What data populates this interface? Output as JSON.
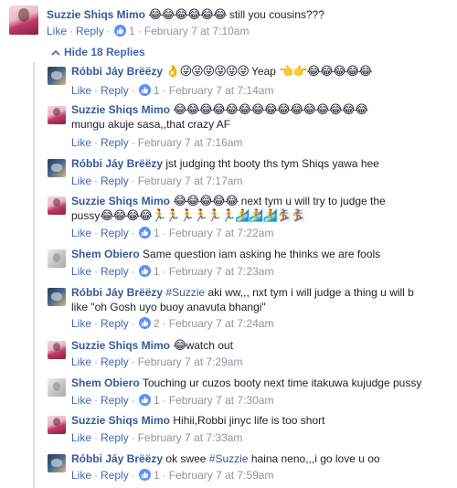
{
  "top_comment": {
    "author": "Suzzie Shiqs Mimo",
    "emojis": "😂😂😂😂😂😂",
    "text": "still you cousins???",
    "like_label": "Like",
    "reply_label": "Reply",
    "like_count": "1",
    "timestamp": "February 7 at 7:10am"
  },
  "hide_replies_label": "Hide 18 Replies",
  "replies": [
    {
      "author": "Róbbi Jáy Brëëzy",
      "pre_emoji": "👌😜😜😜😜😜😜",
      "text": "Yeap",
      "post_emoji": "👈👉😂😂😂😂😂",
      "like_label": "Like",
      "reply_label": "Reply",
      "like_count": "1",
      "timestamp": "February 7 at 7:14am"
    },
    {
      "author": "Suzzie Shiqs Mimo",
      "pre_emoji": "😂😂😂😂😂😂😂😂😂😂😂😂😂😂😂",
      "text": "mungu akuje sasa,,that crazy AF",
      "like_label": "Like",
      "reply_label": "Reply",
      "timestamp": "February 7 at 7:16am"
    },
    {
      "author": "Róbbi Jáy Brëëzy",
      "text": "jst judging tht booty ths tym Shiqs yawa hee",
      "like_label": "Like",
      "reply_label": "Reply",
      "timestamp": "February 7 at 7:17am"
    },
    {
      "author": "Suzzie Shiqs Mimo",
      "pre_emoji": "😂😂😂😂😂",
      "text": "next tym u will try to judge the",
      "text2": "pussy",
      "post_emoji": "😂😂😂😂🏃🏃🏃🏃🏃🏃🏄🏄🏄🏂🏂",
      "like_label": "Like",
      "reply_label": "Reply",
      "like_count": "1",
      "timestamp": "February 7 at 7:22am"
    },
    {
      "author": "Shem Obiero",
      "text": "Same question iam asking he thinks we are fools",
      "like_label": "Like",
      "reply_label": "Reply",
      "like_count": "1",
      "timestamp": "February 7 at 7:23am"
    },
    {
      "author": "Róbbi Jáy Brëëzy",
      "tag": "#Suzzie",
      "text": "aki ww,,, nxt tym i will judge a thing u will b",
      "text2": "like \"oh Gosh uyo buoy anavuta bhangi\"",
      "like_label": "Like",
      "reply_label": "Reply",
      "like_count": "2",
      "timestamp": "February 7 at 7:24am"
    },
    {
      "author": "Suzzie Shiqs Mimo",
      "pre_emoji": "😂",
      "text": "watch out",
      "like_label": "Like",
      "reply_label": "Reply",
      "timestamp": "February 7 at 7:29am"
    },
    {
      "author": "Shem Obiero",
      "text": "Touching ur cuzos booty next time itakuwa kujudge pussy",
      "like_label": "Like",
      "reply_label": "Reply",
      "like_count": "1",
      "timestamp": "February 7 at 7:30am"
    },
    {
      "author": "Suzzie Shiqs Mimo",
      "text": "Hihii,Robbi jinyc life is too short",
      "like_label": "Like",
      "reply_label": "Reply",
      "timestamp": "February 7 at 7:33am"
    },
    {
      "author": "Róbbi Jáy Brëëzy",
      "text_pre": "ok swee",
      "tag": "#Suzzie",
      "text": "haina neno,,,i go love u oo",
      "like_label": "Like",
      "reply_label": "Reply",
      "like_count": "1",
      "timestamp": "February 7 at 7:59am"
    }
  ],
  "icons": {
    "like_badge": "thumbs-up-icon",
    "hide_toggle": "chevron-up-icon"
  },
  "colors": {
    "link": "#365899",
    "action": "#4267b2",
    "meta": "#90949c",
    "like_badge": "#5890ff",
    "thread_line": "#dadde1"
  }
}
